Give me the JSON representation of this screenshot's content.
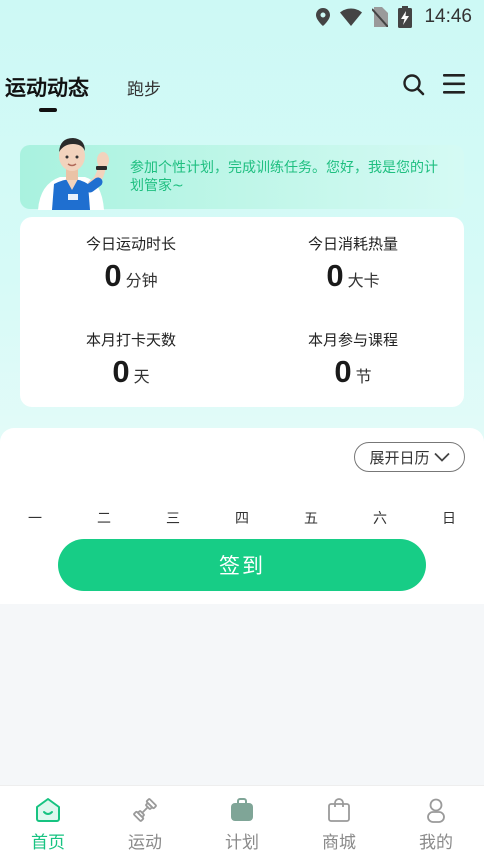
{
  "status_bar": {
    "time": "14:46",
    "icons": [
      "location-icon",
      "wifi-icon",
      "no-sim-icon",
      "battery-charging-icon"
    ]
  },
  "header": {
    "tabs": [
      {
        "label": "运动动态",
        "active": true
      },
      {
        "label": "跑步",
        "active": false
      }
    ],
    "icons": [
      "search-icon",
      "menu-icon"
    ]
  },
  "banner": {
    "text": "参加个性计划，完成训练任务。您好，我是您的计划管家~",
    "accent_color": "#1fbf80"
  },
  "stats": [
    {
      "label": "今日运动时长",
      "value": "0",
      "unit": "分钟"
    },
    {
      "label": "今日消耗热量",
      "value": "0",
      "unit": "大卡"
    },
    {
      "label": "本月打卡天数",
      "value": "0",
      "unit": "天"
    },
    {
      "label": "本月参与课程",
      "value": "0",
      "unit": "节"
    }
  ],
  "calendar": {
    "expand_label": "展开日历",
    "weekdays": [
      "一",
      "二",
      "三",
      "四",
      "五",
      "六",
      "日"
    ],
    "checkin_label": "签到",
    "checkin_color": "#17cd86"
  },
  "bottom_nav": {
    "active_color": "#17c381",
    "items": [
      {
        "label": "首页",
        "icon": "home-icon",
        "active": true
      },
      {
        "label": "运动",
        "icon": "dumbbell-icon",
        "active": false
      },
      {
        "label": "计划",
        "icon": "plan-bag-icon",
        "active": false
      },
      {
        "label": "商城",
        "icon": "shopping-bag-icon",
        "active": false
      },
      {
        "label": "我的",
        "icon": "profile-icon",
        "active": false
      }
    ]
  }
}
